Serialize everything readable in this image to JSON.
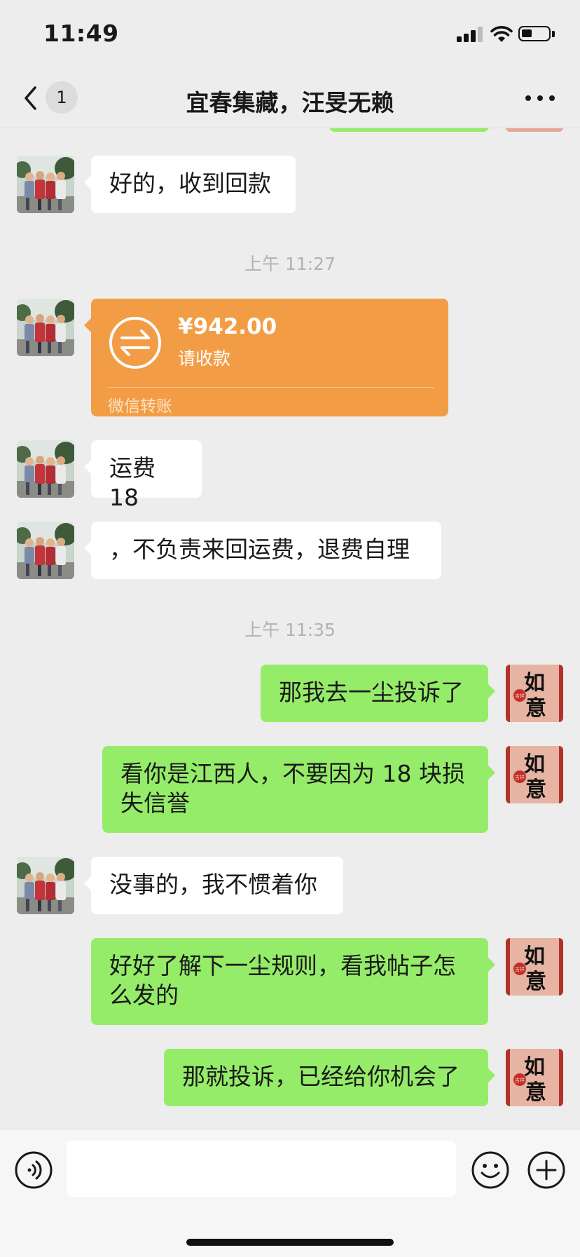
{
  "status_bar": {
    "time": "11:49"
  },
  "nav": {
    "unread_count": "1",
    "title": "宜春集藏，汪旻无赖"
  },
  "messages": [
    {
      "side": "in",
      "text": "好的，收到回款"
    },
    {
      "type": "time",
      "text": "上午 11:27"
    },
    {
      "side": "in",
      "type": "transfer",
      "amount": "¥942.00",
      "status": "请收款",
      "label": "微信转账"
    },
    {
      "side": "in",
      "text": "运费 18"
    },
    {
      "side": "in",
      "text": "，不负责来回运费，退费自理"
    },
    {
      "type": "time",
      "text": "上午 11:35"
    },
    {
      "side": "out",
      "text": "那我去一尘投诉了"
    },
    {
      "side": "out",
      "text": "看你是江西人，不要因为 18 块损失信誉"
    },
    {
      "side": "in",
      "text": "没事的，我不惯着你"
    },
    {
      "side": "out",
      "text": "好好了解下一尘规则，看我帖子怎么发的"
    },
    {
      "side": "out",
      "text": "那就投诉，已经给你机会了"
    }
  ],
  "avatars": {
    "self_glyphs": "如意",
    "self_seal_text": "吉祥"
  },
  "icons": {
    "back": "chevron-left-icon",
    "more": "more-dots-icon",
    "voice": "voice-icon",
    "emoji": "emoji-icon",
    "plus": "plus-icon",
    "transfer": "transfer-arrows-icon",
    "signal": "signal-icon",
    "wifi": "wifi-icon",
    "battery": "battery-icon"
  },
  "colors": {
    "background": "#ededed",
    "bubble_out": "#95ec69",
    "bubble_in": "#ffffff",
    "transfer": "#f29d46",
    "timestamp": "#b2b2b2"
  }
}
